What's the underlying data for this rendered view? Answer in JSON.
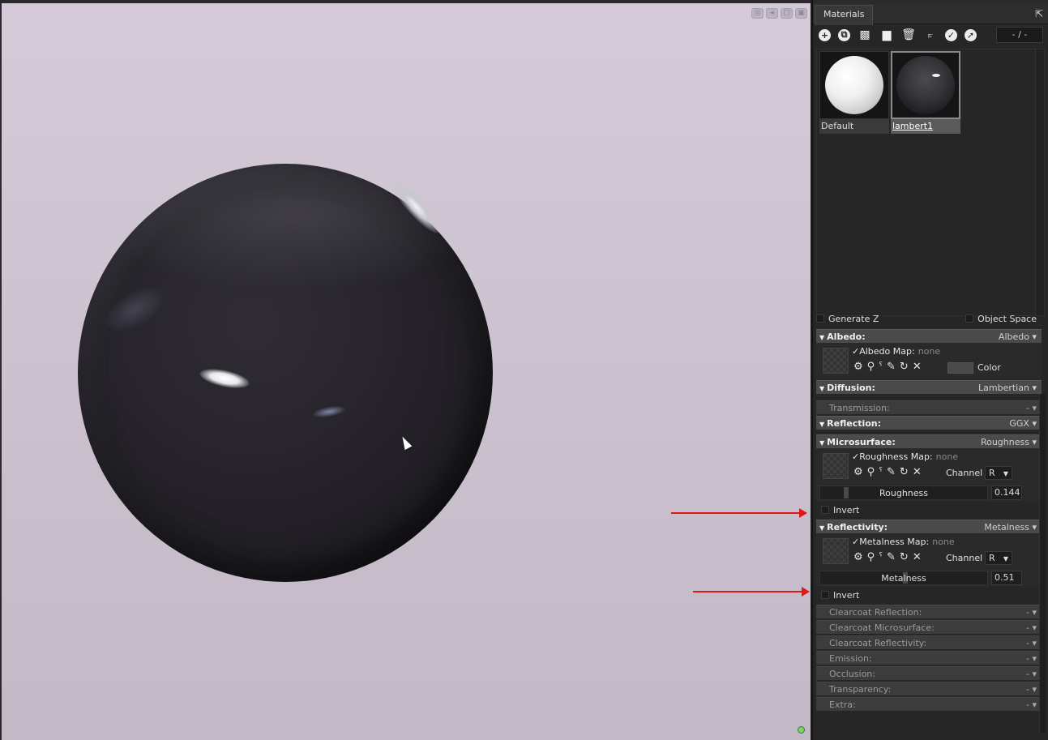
{
  "viewport": {
    "icons": [
      "camera-icon",
      "audio-icon",
      "frame-icon",
      "image-icon"
    ]
  },
  "panel": {
    "tab_label": "Materials",
    "toolbar_icons": [
      "new-material-icon",
      "duplicate-icon",
      "checker-icon",
      "folder-icon",
      "delete-icon",
      "pick-icon",
      "select-icon",
      "export-icon"
    ],
    "page_indicator": "- / -",
    "materials": [
      {
        "name": "Default",
        "selected": false
      },
      {
        "name": "lambert1",
        "selected": true
      }
    ],
    "generate_z_label": "Generate Z",
    "object_space_label": "Object Space",
    "albedo": {
      "title": "Albedo:",
      "mode": "Albedo",
      "map_label": "Albedo Map:",
      "map_value": "none",
      "color_label": "Color"
    },
    "diffusion": {
      "title": "Diffusion:",
      "mode": "Lambertian"
    },
    "transmission": {
      "title": "Transmission:",
      "mode": "-"
    },
    "reflection": {
      "title": "Reflection:",
      "mode": "GGX"
    },
    "microsurface": {
      "title": "Microsurface:",
      "mode": "Roughness",
      "map_label": "Roughness Map:",
      "map_value": "none",
      "channel_label": "Channel",
      "channel_value": "R",
      "slider_label": "Roughness",
      "slider_value": "0.144",
      "slider_fraction": 0.144,
      "invert_label": "Invert"
    },
    "reflectivity": {
      "title": "Reflectivity:",
      "mode": "Metalness",
      "map_label": "Metalness Map:",
      "map_value": "none",
      "channel_label": "Channel",
      "channel_value": "R",
      "slider_label": "Metalness",
      "slider_value": "0.51",
      "slider_fraction": 0.51,
      "invert_label": "Invert"
    },
    "collapsed_sections": [
      {
        "title": "Clearcoat Reflection:",
        "mode": "-"
      },
      {
        "title": "Clearcoat Microsurface:",
        "mode": "-"
      },
      {
        "title": "Clearcoat Reflectivity:",
        "mode": "-"
      },
      {
        "title": "Emission:",
        "mode": "-"
      },
      {
        "title": "Occlusion:",
        "mode": "-"
      },
      {
        "title": "Transparency:",
        "mode": "-"
      },
      {
        "title": "Extra:",
        "mode": "-"
      }
    ]
  },
  "annotation_color": "#e01818"
}
